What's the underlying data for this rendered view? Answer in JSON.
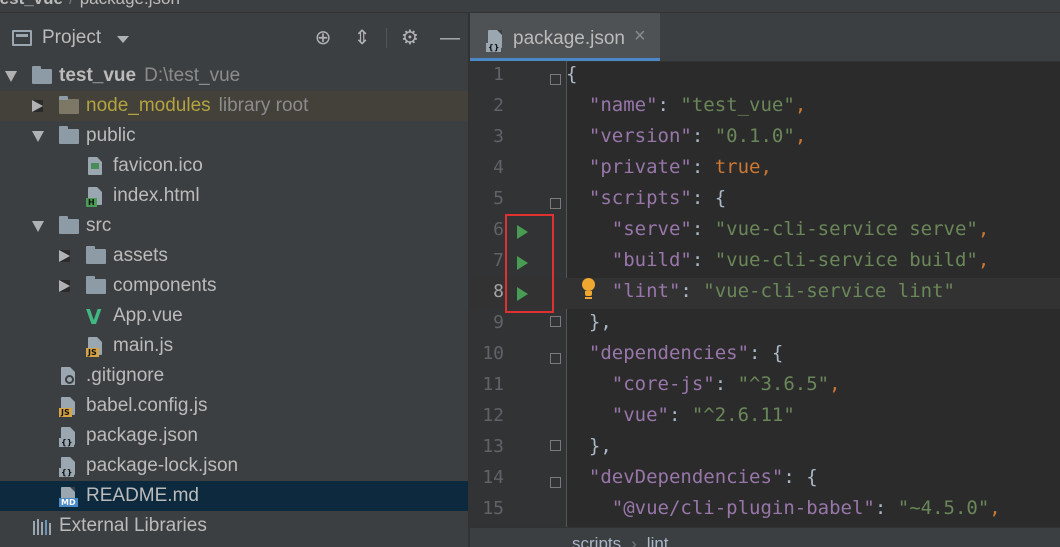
{
  "topbar": {
    "root": "test_vue",
    "file": "package.json"
  },
  "project": {
    "title": "Project",
    "tools": {
      "locate": "⊕",
      "collapse": "⇕",
      "settings": "⚙",
      "hide": "—"
    }
  },
  "tree": {
    "root": {
      "name": "test_vue",
      "path": "D:\\test_vue"
    },
    "node_modules": {
      "name": "node_modules",
      "hint": "library root"
    },
    "public": {
      "name": "public"
    },
    "favicon": {
      "name": "favicon.ico"
    },
    "index_html": {
      "name": "index.html",
      "badge": "H"
    },
    "src": {
      "name": "src"
    },
    "assets": {
      "name": "assets"
    },
    "components": {
      "name": "components"
    },
    "app_vue": {
      "name": "App.vue"
    },
    "main_js": {
      "name": "main.js",
      "badge": "JS"
    },
    "gitignore": {
      "name": ".gitignore"
    },
    "babel_config": {
      "name": "babel.config.js",
      "badge": "JS"
    },
    "package_json": {
      "name": "package.json",
      "badge": "{}"
    },
    "package_lock": {
      "name": "package-lock.json",
      "badge": "{}"
    },
    "readme": {
      "name": "README.md",
      "badge": "MD"
    },
    "external": {
      "name": "External Libraries"
    }
  },
  "editor": {
    "tab": {
      "name": "package.json",
      "close": "×"
    },
    "lines": [
      {
        "n": "1"
      },
      {
        "n": "2"
      },
      {
        "n": "3"
      },
      {
        "n": "4"
      },
      {
        "n": "5"
      },
      {
        "n": "6"
      },
      {
        "n": "7"
      },
      {
        "n": "8"
      },
      {
        "n": "9"
      },
      {
        "n": "10"
      },
      {
        "n": "11"
      },
      {
        "n": "12"
      },
      {
        "n": "13"
      },
      {
        "n": "14"
      },
      {
        "n": "15"
      }
    ],
    "code": {
      "l1": "{",
      "name_k": "\"name\"",
      "name_v": "\"test_vue\"",
      "version_k": "\"version\"",
      "version_v": "\"0.1.0\"",
      "private_k": "\"private\"",
      "private_v": "true",
      "scripts_k": "\"scripts\"",
      "serve_k": "\"serve\"",
      "serve_v": "\"vue-cli-service serve\"",
      "build_k": "\"build\"",
      "build_v": "\"vue-cli-service build\"",
      "lint_k": "\"lint\"",
      "lint_v": "\"vue-cli-service lint\"",
      "l9": "},",
      "deps_k": "\"dependencies\"",
      "corejs_k": "\"core-js\"",
      "corejs_v": "\"^3.6.5\"",
      "vue_k": "\"vue\"",
      "vue_v": "\"^2.6.11\"",
      "l13": "},",
      "devdeps_k": "\"devDependencies\"",
      "babel_k": "\"@vue/cli-plugin-babel\"",
      "babel_v": "\"~4.5.0\""
    },
    "breadcrumb": {
      "a": "scripts",
      "b": "lint"
    }
  },
  "colors": {
    "accent": "#4a88c7",
    "run": "#499c54",
    "highlight": "#e03030",
    "bulb": "#f0a732"
  }
}
